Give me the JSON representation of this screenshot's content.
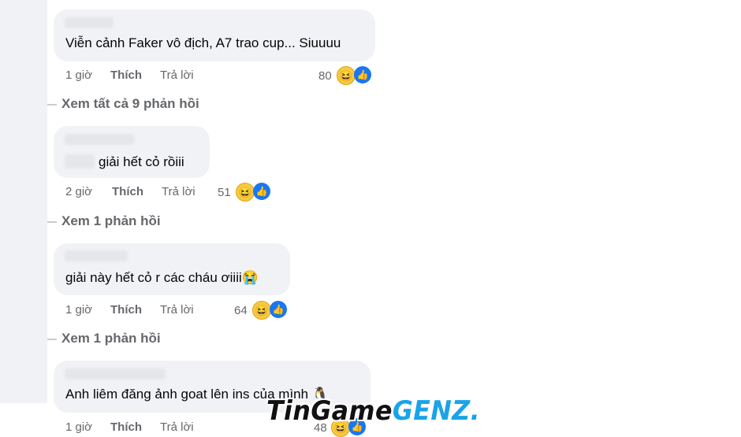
{
  "comments": [
    {
      "text": "Viễn cảnh Faker vô địch, A7 trao cup... Siuuuu",
      "time": "1 giờ",
      "like_label": "Thích",
      "reply_label": "Trả lời",
      "reaction_count": "80",
      "view_replies": "Xem tất cả 9 phản hồi"
    },
    {
      "text": "giải hết cỏ rồiii",
      "time": "2 giờ",
      "like_label": "Thích",
      "reply_label": "Trả lời",
      "reaction_count": "51",
      "view_replies": "Xem 1 phản hồi"
    },
    {
      "text": "giải này hết cỏ r các cháu ơiiii😭",
      "time": "1 giờ",
      "like_label": "Thích",
      "reply_label": "Trả lời",
      "reaction_count": "64",
      "view_replies": "Xem 1 phản hồi"
    },
    {
      "text": "Anh liêm đăng ảnh goat lên ins của mình 🐧",
      "time": "1 giờ",
      "like_label": "Thích",
      "reply_label": "Trả lời",
      "reaction_count": "48"
    }
  ],
  "watermark": {
    "part1": "TinGame",
    "part2": "GENZ."
  },
  "icons": {
    "haha": "haha-reaction-icon",
    "like": "like-reaction-icon"
  },
  "colors": {
    "bubble": "#f0f2f5",
    "like_blue": "#1877f2",
    "meta_gray": "#65676b"
  }
}
